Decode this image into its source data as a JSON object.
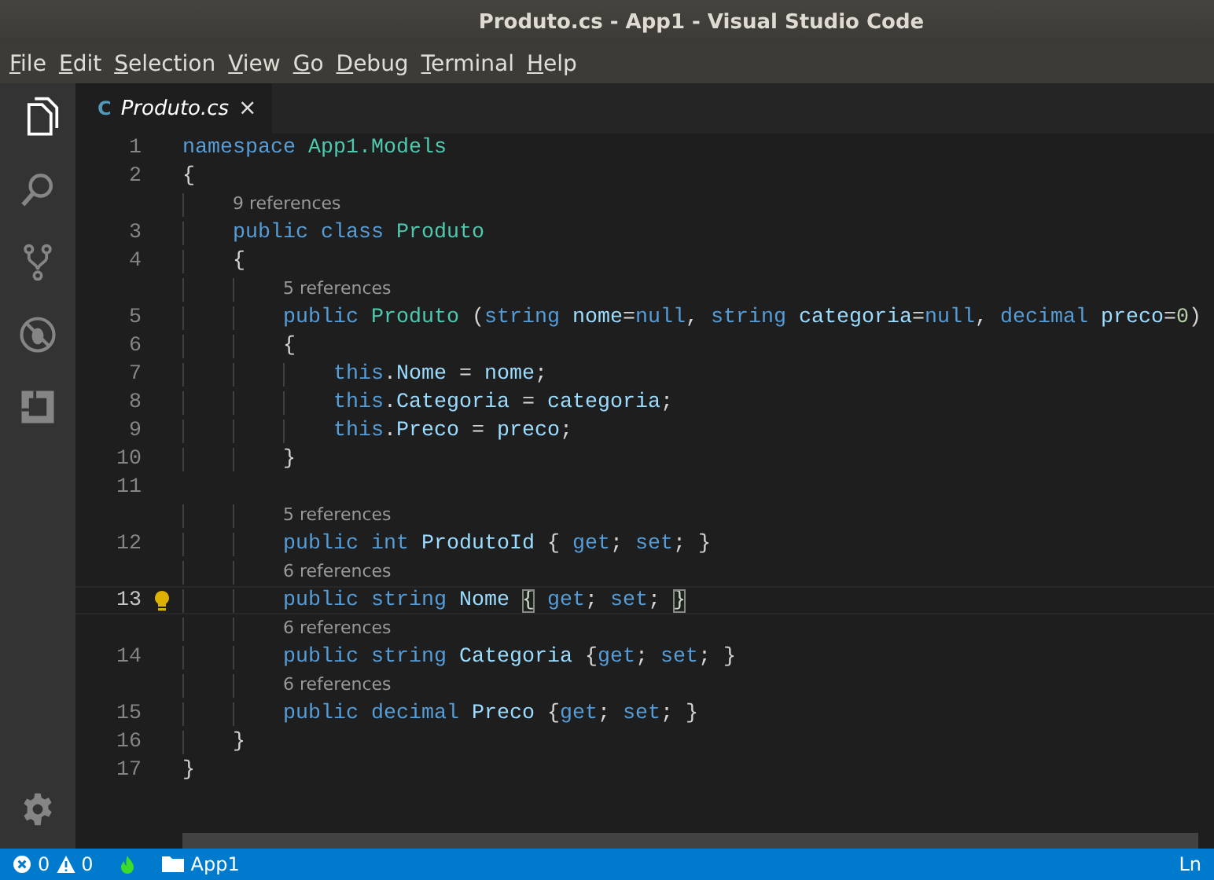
{
  "window": {
    "title": "Produto.cs - App1 - Visual Studio Code"
  },
  "menu": [
    {
      "label": "File",
      "underline_first": true
    },
    {
      "label": "Edit",
      "underline_first": true
    },
    {
      "label": "Selection",
      "underline_first": true
    },
    {
      "label": "View",
      "underline_first": true
    },
    {
      "label": "Go",
      "underline_first": true
    },
    {
      "label": "Debug",
      "underline_first": true
    },
    {
      "label": "Terminal",
      "underline_first": true
    },
    {
      "label": "Help",
      "underline_first": true
    }
  ],
  "activity_bar": [
    {
      "kind": "files",
      "selected": true
    },
    {
      "kind": "search",
      "selected": false
    },
    {
      "kind": "source-control",
      "selected": false
    },
    {
      "kind": "debug",
      "selected": false
    },
    {
      "kind": "extensions",
      "selected": false
    }
  ],
  "tabs": [
    {
      "label": "Produto.cs",
      "icon": "C",
      "close": "×",
      "selected": true
    }
  ],
  "editor": {
    "lines": [
      {
        "number": "1",
        "tokens": [
          {
            "kind": "keyword",
            "text": "namespace "
          },
          {
            "kind": "type",
            "text": "App1.Models"
          }
        ]
      },
      {
        "number": "2",
        "tokens": [
          {
            "kind": "plain",
            "text": "{"
          }
        ],
        "children": [
          {
            "number": "3",
            "lens": "9 references",
            "tokens": [
              {
                "kind": "keyword",
                "text": "public class "
              },
              {
                "kind": "type",
                "text": "Produto"
              }
            ]
          },
          {
            "number": "4",
            "tokens": [
              {
                "kind": "plain",
                "text": "{"
              }
            ],
            "children": [
              {
                "number": "5",
                "lens": "5 references",
                "tokens": [
                  {
                    "kind": "keyword",
                    "text": "public "
                  },
                  {
                    "kind": "type",
                    "text": "Produto "
                  },
                  {
                    "kind": "plain",
                    "text": "("
                  },
                  {
                    "kind": "keyword",
                    "text": "string "
                  },
                  {
                    "kind": "variable",
                    "text": "nome"
                  },
                  {
                    "kind": "plain",
                    "text": "="
                  },
                  {
                    "kind": "keyword",
                    "text": "null"
                  },
                  {
                    "kind": "plain",
                    "text": ", "
                  },
                  {
                    "kind": "keyword",
                    "text": "string "
                  },
                  {
                    "kind": "variable",
                    "text": "categoria"
                  },
                  {
                    "kind": "plain",
                    "text": "="
                  },
                  {
                    "kind": "keyword",
                    "text": "null"
                  },
                  {
                    "kind": "plain",
                    "text": ", "
                  },
                  {
                    "kind": "keyword",
                    "text": "decimal "
                  },
                  {
                    "kind": "variable",
                    "text": "preco"
                  },
                  {
                    "kind": "plain",
                    "text": "="
                  },
                  {
                    "kind": "number",
                    "text": "0"
                  },
                  {
                    "kind": "plain",
                    "text": ")"
                  }
                ]
              },
              {
                "number": "6",
                "tokens": [
                  {
                    "kind": "plain",
                    "text": "{"
                  }
                ],
                "children": [
                  {
                    "number": "7",
                    "tokens": [
                      {
                        "kind": "keyword",
                        "text": "this"
                      },
                      {
                        "kind": "plain",
                        "text": "."
                      },
                      {
                        "kind": "variable",
                        "text": "Nome"
                      },
                      {
                        "kind": "plain",
                        "text": " = "
                      },
                      {
                        "kind": "variable",
                        "text": "nome"
                      },
                      {
                        "kind": "plain",
                        "text": ";"
                      }
                    ]
                  },
                  {
                    "number": "8",
                    "tokens": [
                      {
                        "kind": "keyword",
                        "text": "this"
                      },
                      {
                        "kind": "plain",
                        "text": "."
                      },
                      {
                        "kind": "variable",
                        "text": "Categoria"
                      },
                      {
                        "kind": "plain",
                        "text": " = "
                      },
                      {
                        "kind": "variable",
                        "text": "categoria"
                      },
                      {
                        "kind": "plain",
                        "text": ";"
                      }
                    ]
                  },
                  {
                    "number": "9",
                    "tokens": [
                      {
                        "kind": "keyword",
                        "text": "this"
                      },
                      {
                        "kind": "plain",
                        "text": "."
                      },
                      {
                        "kind": "variable",
                        "text": "Preco"
                      },
                      {
                        "kind": "plain",
                        "text": " = "
                      },
                      {
                        "kind": "variable",
                        "text": "preco"
                      },
                      {
                        "kind": "plain",
                        "text": ";"
                      }
                    ]
                  }
                ]
              },
              {
                "number": "10",
                "tokens": [
                  {
                    "kind": "plain",
                    "text": "}"
                  }
                ]
              },
              {
                "number": "11"
              },
              {
                "number": "12",
                "lens": "5 references",
                "tokens": [
                  {
                    "kind": "keyword",
                    "text": "public int "
                  },
                  {
                    "kind": "variable",
                    "text": "ProdutoId"
                  },
                  {
                    "kind": "plain",
                    "text": " { "
                  },
                  {
                    "kind": "keyword",
                    "text": "get"
                  },
                  {
                    "kind": "plain",
                    "text": "; "
                  },
                  {
                    "kind": "keyword",
                    "text": "set"
                  },
                  {
                    "kind": "plain",
                    "text": "; }"
                  }
                ]
              },
              {
                "number": "13",
                "lens": "6 references",
                "current": true,
                "lightbulb": true,
                "tokens": [
                  {
                    "kind": "keyword",
                    "text": "public string "
                  },
                  {
                    "kind": "variable",
                    "text": "Nome "
                  },
                  {
                    "kind": "bracket-match",
                    "text": "{"
                  },
                  {
                    "kind": "keyword",
                    "text": " get"
                  },
                  {
                    "kind": "plain",
                    "text": "; "
                  },
                  {
                    "kind": "keyword",
                    "text": "set"
                  },
                  {
                    "kind": "plain",
                    "text": "; "
                  },
                  {
                    "kind": "bracket-match",
                    "text": "}"
                  }
                ]
              },
              {
                "number": "14",
                "lens": "6 references",
                "tokens": [
                  {
                    "kind": "keyword",
                    "text": "public string "
                  },
                  {
                    "kind": "variable",
                    "text": "Categoria"
                  },
                  {
                    "kind": "plain",
                    "text": " {"
                  },
                  {
                    "kind": "keyword",
                    "text": "get"
                  },
                  {
                    "kind": "plain",
                    "text": "; "
                  },
                  {
                    "kind": "keyword",
                    "text": "set"
                  },
                  {
                    "kind": "plain",
                    "text": "; }"
                  }
                ]
              },
              {
                "number": "15",
                "lens": "6 references",
                "tokens": [
                  {
                    "kind": "keyword",
                    "text": "public decimal "
                  },
                  {
                    "kind": "variable",
                    "text": "Preco"
                  },
                  {
                    "kind": "plain",
                    "text": " {"
                  },
                  {
                    "kind": "keyword",
                    "text": "get"
                  },
                  {
                    "kind": "plain",
                    "text": "; "
                  },
                  {
                    "kind": "keyword",
                    "text": "set"
                  },
                  {
                    "kind": "plain",
                    "text": "; }"
                  }
                ]
              }
            ]
          },
          {
            "number": "16",
            "tokens": [
              {
                "kind": "plain",
                "text": "}"
              }
            ]
          }
        ]
      },
      {
        "number": "17",
        "tokens": [
          {
            "kind": "plain",
            "text": "}"
          }
        ]
      }
    ]
  },
  "status_bar": {
    "errors": "0",
    "warnings": "0",
    "folder": "App1",
    "position": "Ln"
  }
}
